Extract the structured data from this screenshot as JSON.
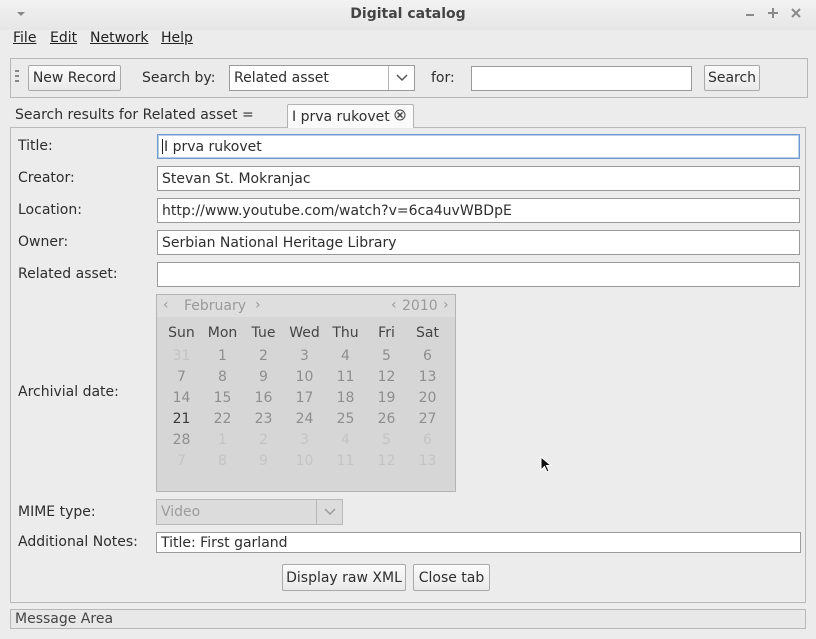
{
  "window": {
    "title": "Digital catalog",
    "menu_icon": "chevron-down-icon",
    "controls": [
      "minimize-icon",
      "maximize-icon",
      "close-icon"
    ]
  },
  "menu": {
    "file": "File",
    "edit": "Edit",
    "network": "Network",
    "help": "Help"
  },
  "toolbar": {
    "new_record": "New Record",
    "search_by_label": "Search by:",
    "search_by_value": "Related asset",
    "for_label": "for:",
    "search_value": "",
    "search_button": "Search"
  },
  "results": {
    "label": "Search results for Related asset =",
    "tab_label": "I prva rukovet"
  },
  "form": {
    "title_label": "Title:",
    "title_value": "I prva rukovet",
    "creator_label": "Creator:",
    "creator_value": "Stevan St. Mokranjac",
    "location_label": "Location:",
    "location_value": "http://www.youtube.com/watch?v=6ca4uvWBDpE",
    "owner_label": "Owner:",
    "owner_value": "Serbian National Heritage Library",
    "related_label": "Related asset:",
    "related_value": "",
    "date_label": "Archivial date:",
    "mime_label": "MIME type:",
    "mime_value": "Video",
    "notes_label": "Additional Notes:",
    "notes_value": "Title: First garland"
  },
  "calendar": {
    "month": "February",
    "year": "2010",
    "weekdays": [
      "Sun",
      "Mon",
      "Tue",
      "Wed",
      "Thu",
      "Fri",
      "Sat"
    ],
    "selected_day": "21",
    "weeks": [
      [
        "31",
        "1",
        "2",
        "3",
        "4",
        "5",
        "6"
      ],
      [
        "7",
        "8",
        "9",
        "10",
        "11",
        "12",
        "13"
      ],
      [
        "14",
        "15",
        "16",
        "17",
        "18",
        "19",
        "20"
      ],
      [
        "21",
        "22",
        "23",
        "24",
        "25",
        "26",
        "27"
      ],
      [
        "28",
        "1",
        "2",
        "3",
        "4",
        "5",
        "6"
      ],
      [
        "7",
        "8",
        "9",
        "10",
        "11",
        "12",
        "13"
      ]
    ]
  },
  "actions": {
    "raw_xml": "Display raw XML",
    "close_tab": "Close tab"
  },
  "status": {
    "message": "Message Area"
  }
}
